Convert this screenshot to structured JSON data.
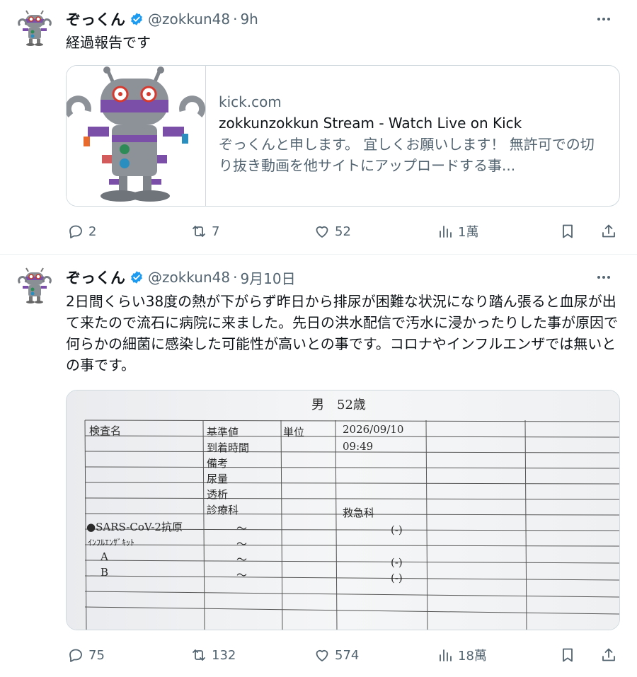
{
  "tweets": [
    {
      "author_name": "ぞっくん",
      "handle": "@zokkun48",
      "time": "9h",
      "text": "経過報告です",
      "card": {
        "domain": "kick.com",
        "title": "zokkunzokkun Stream - Watch Live on Kick",
        "description": "ぞっくんと申します。 宜しくお願いします！ 無許可での切り抜き動画を他サイトにアップロードする事..."
      },
      "actions": {
        "replies": "2",
        "retweets": "7",
        "likes": "52",
        "views": "1萬"
      }
    },
    {
      "author_name": "ぞっくん",
      "handle": "@zokkun48",
      "time": "9月10日",
      "text": "2日間くらい38度の熱が下がらず昨日から排尿が困難な状況になり踏ん張ると血尿が出て来たので流石に病院に来ました。先日の洪水配信で汚水に浸かったりした事が原因で何らかの細菌に感染した可能性が高いとの事です。コロナやインフルエンザでは無いとの事です。",
      "document": {
        "header": "男　52歳",
        "col_test": "検査名",
        "col_ref": "基準値",
        "col_unit": "単位",
        "date": "2026/09/10",
        "r1": "到着時間",
        "time": "09:49",
        "r2": "備考",
        "r3": "尿量",
        "r4": "透析",
        "r5": "診療科",
        "dept": "救急科",
        "t1": "●SARS-CoV-2抗原",
        "t2": "ｲﾝﾌﾙｴﾝｻﾞｷｯﾄ",
        "t3": "A",
        "t4": "B",
        "tilde": "～",
        "neg": "(-)"
      },
      "actions": {
        "replies": "75",
        "retweets": "132",
        "likes": "574",
        "views": "18萬"
      }
    }
  ],
  "colors": {
    "verified": "#1d9bf0",
    "secondary_text": "#536471",
    "border": "#cfd9de"
  }
}
